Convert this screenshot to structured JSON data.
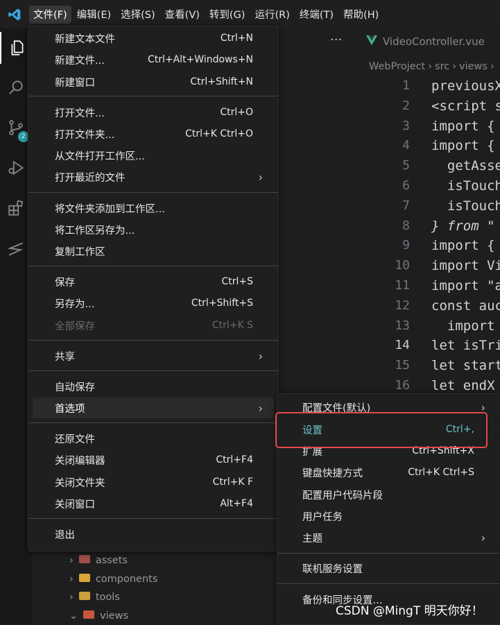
{
  "menubar": {
    "items": [
      "文件(F)",
      "编辑(E)",
      "选择(S)",
      "查看(V)",
      "转到(G)",
      "运行(R)",
      "终端(T)",
      "帮助(H)"
    ]
  },
  "activity_bar": {
    "source_control_badge": "2"
  },
  "editor": {
    "tab_more": "···",
    "tab_name": "VideoController.vue",
    "breadcrumb": [
      "WebProject",
      "src",
      "views",
      "›"
    ],
    "lines": [
      {
        "n": "1",
        "text": "previousX"
      },
      {
        "n": "2",
        "text": "<script s"
      },
      {
        "n": "3",
        "text": "import {"
      },
      {
        "n": "4",
        "text": "import {"
      },
      {
        "n": "5",
        "text": "  getAsse"
      },
      {
        "n": "6",
        "text": "  isTouch"
      },
      {
        "n": "7",
        "text": "  isTouch"
      },
      {
        "n": "8",
        "text": "} from \""
      },
      {
        "n": "9",
        "text": "import {"
      },
      {
        "n": "10",
        "text": "import Vi"
      },
      {
        "n": "11",
        "text": "import \"a"
      },
      {
        "n": "12",
        "text": "const auc"
      },
      {
        "n": "13",
        "text": "  import"
      },
      {
        "n": "14",
        "text": "let isTri"
      },
      {
        "n": "15",
        "text": "let start"
      },
      {
        "n": "16",
        "text": "let endX"
      }
    ]
  },
  "explorer": {
    "folders": [
      "assets",
      "components",
      "tools",
      "views"
    ]
  },
  "file_menu": {
    "items": [
      {
        "label": "新建文本文件",
        "key": "Ctrl+N"
      },
      {
        "label": "新建文件...",
        "key": "Ctrl+Alt+Windows+N"
      },
      {
        "label": "新建窗口",
        "key": "Ctrl+Shift+N"
      },
      {
        "label": "打开文件...",
        "key": "Ctrl+O"
      },
      {
        "label": "打开文件夹...",
        "key": "Ctrl+K Ctrl+O"
      },
      {
        "label": "从文件打开工作区...",
        "key": ""
      },
      {
        "label": "打开最近的文件",
        "key": ""
      },
      {
        "label": "将文件夹添加到工作区...",
        "key": ""
      },
      {
        "label": "将工作区另存为...",
        "key": ""
      },
      {
        "label": "复制工作区",
        "key": ""
      },
      {
        "label": "保存",
        "key": "Ctrl+S"
      },
      {
        "label": "另存为...",
        "key": "Ctrl+Shift+S"
      },
      {
        "label": "全部保存",
        "key": "Ctrl+K S"
      },
      {
        "label": "共享",
        "key": ""
      },
      {
        "label": "自动保存",
        "key": ""
      },
      {
        "label": "首选项",
        "key": ""
      },
      {
        "label": "还原文件",
        "key": ""
      },
      {
        "label": "关闭编辑器",
        "key": "Ctrl+F4"
      },
      {
        "label": "关闭文件夹",
        "key": "Ctrl+K F"
      },
      {
        "label": "关闭窗口",
        "key": "Alt+F4"
      },
      {
        "label": "退出",
        "key": ""
      }
    ]
  },
  "preferences_menu": {
    "items": [
      {
        "label": "配置文件(默认)",
        "key": ""
      },
      {
        "label": "设置",
        "key": "Ctrl+,"
      },
      {
        "label": "扩展",
        "key": "Ctrl+Shift+X"
      },
      {
        "label": "键盘快捷方式",
        "key": "Ctrl+K Ctrl+S"
      },
      {
        "label": "配置用户代码片段",
        "key": ""
      },
      {
        "label": "用户任务",
        "key": ""
      },
      {
        "label": "主题",
        "key": ""
      },
      {
        "label": "联机服务设置",
        "key": ""
      },
      {
        "label": "备份和同步设置...",
        "key": ""
      }
    ]
  },
  "watermark": "CSDN @MingT 明天你好！",
  "colors": {
    "accent_focus": "#6cc3c9",
    "highlight_border": "#e5484d",
    "vscode_blue": "#3aa7e8",
    "vue_green": "#41b883"
  }
}
